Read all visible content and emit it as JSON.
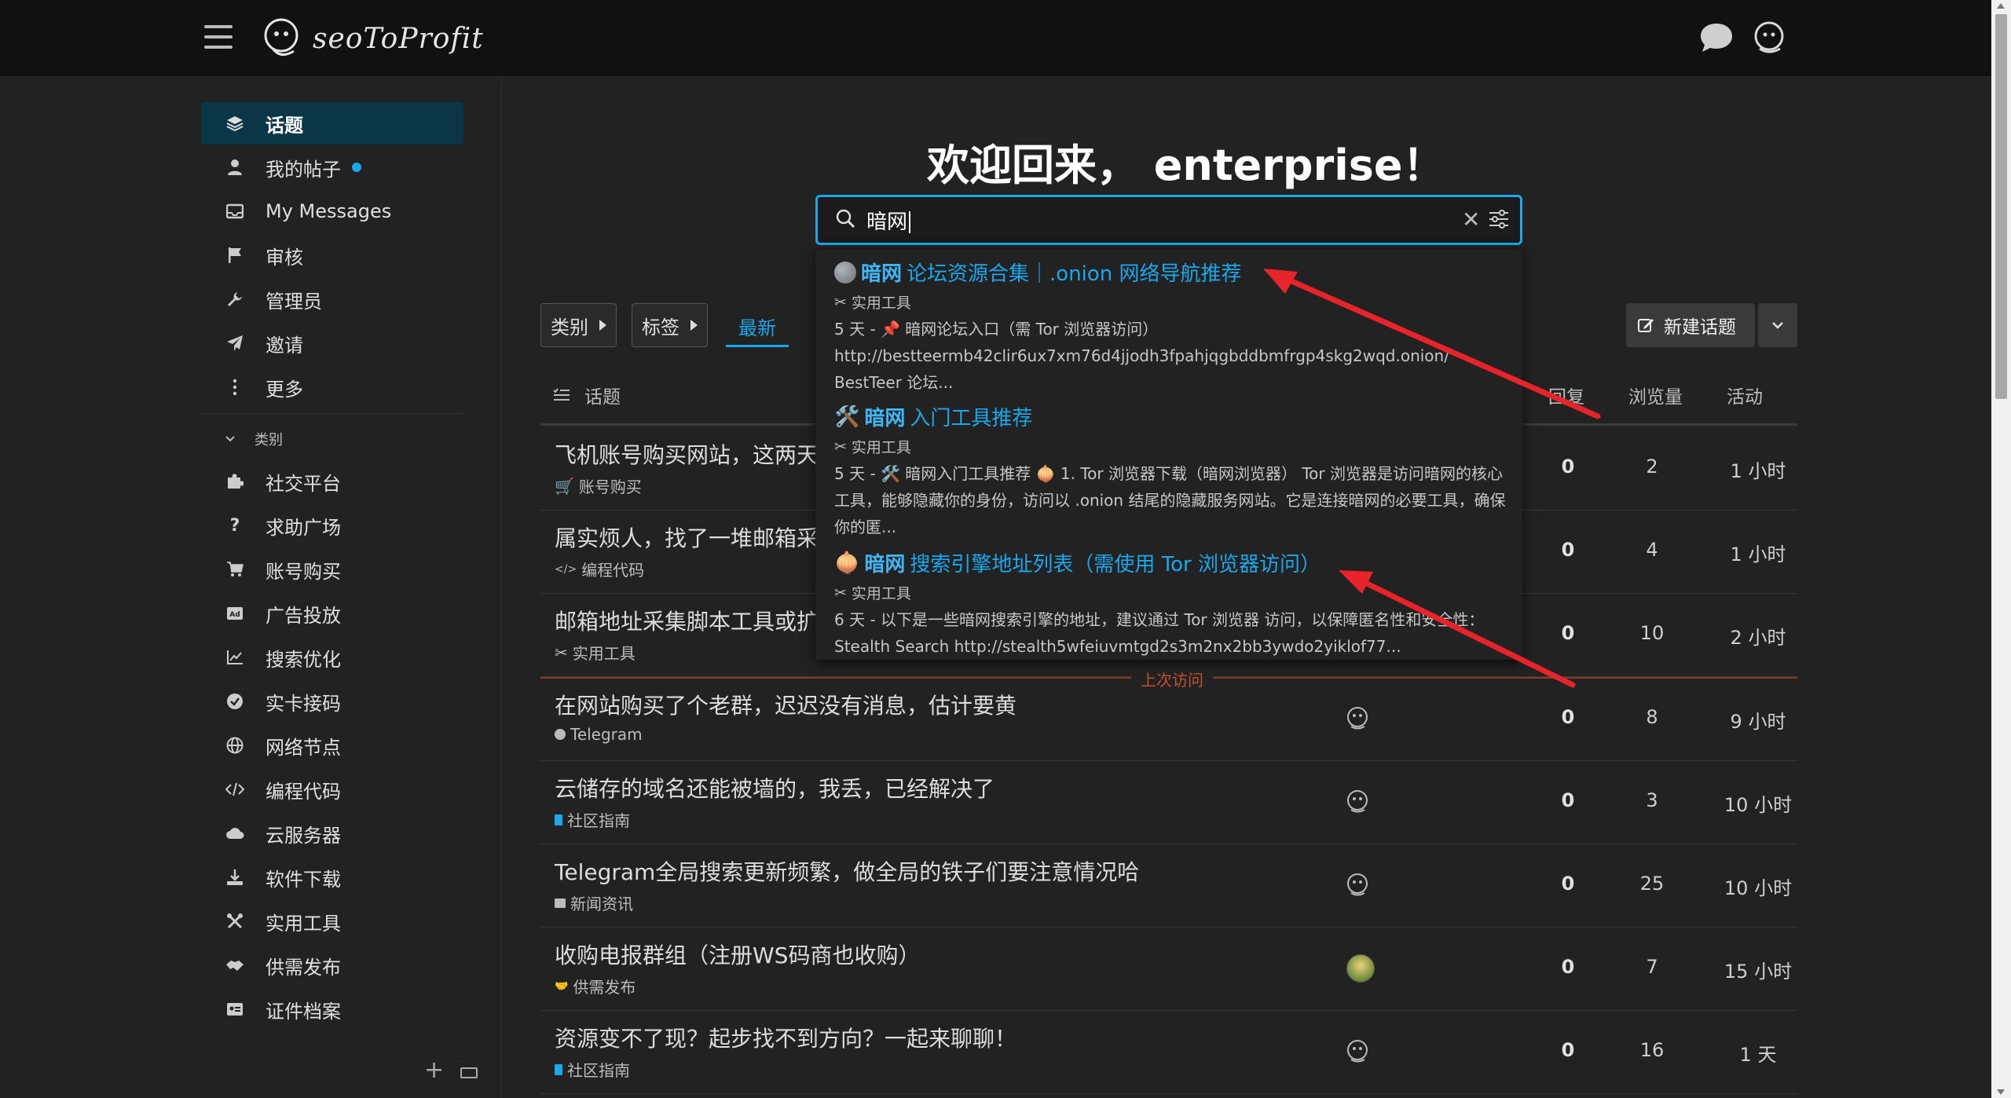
{
  "header": {
    "logo_text": "seoToProfit",
    "menu_icon": "hamburger-icon",
    "chat_icon": "chat-bubble-icon",
    "avatar_icon": "user-avatar-icon"
  },
  "sidebar": {
    "items": [
      {
        "label": "话题",
        "icon": "layers-icon",
        "active": true
      },
      {
        "label": "我的帖子",
        "icon": "user-icon",
        "dot": true
      },
      {
        "label": "My Messages",
        "icon": "inbox-icon"
      },
      {
        "label": "审核",
        "icon": "flag-icon"
      },
      {
        "label": "管理员",
        "icon": "wrench-icon"
      },
      {
        "label": "邀请",
        "icon": "paper-plane-icon"
      },
      {
        "label": "更多",
        "icon": "more-vertical-icon"
      }
    ],
    "categories_header": "类别",
    "categories": [
      {
        "label": "社交平台",
        "icon": "puzzle-icon"
      },
      {
        "label": "求助广场",
        "icon": "question-icon"
      },
      {
        "label": "账号购买",
        "icon": "cart-icon"
      },
      {
        "label": "广告投放",
        "icon": "ad-icon"
      },
      {
        "label": "搜索优化",
        "icon": "chart-line-icon"
      },
      {
        "label": "实卡接码",
        "icon": "check-circle-icon"
      },
      {
        "label": "网络节点",
        "icon": "globe-icon"
      },
      {
        "label": "编程代码",
        "icon": "code-icon"
      },
      {
        "label": "云服务器",
        "icon": "cloud-icon"
      },
      {
        "label": "软件下载",
        "icon": "download-icon"
      },
      {
        "label": "实用工具",
        "icon": "tools-icon"
      },
      {
        "label": "供需发布",
        "icon": "handshake-icon"
      },
      {
        "label": "证件档案",
        "icon": "id-card-icon"
      }
    ]
  },
  "main": {
    "welcome": "欢迎回来， enterprise！",
    "search": {
      "value": "暗网"
    },
    "results": [
      {
        "title_bold": "暗网",
        "title_rest": "论坛资源合集｜.onion 网络导航推荐",
        "category": "实用工具",
        "body": "5 天 - 📌 暗网论坛入口（需 Tor 浏览器访问）\nhttp://bestteermb42clir6ux7xm76d4jjodh3fpahjqgbddbmfrgp4skg2wqd.onion/\nBestTeer 论坛..."
      },
      {
        "title_bold": "暗网",
        "title_rest": "入门工具推荐",
        "category": "实用工具",
        "body": "5 天 - 🛠️ 暗网入门工具推荐 🧅 1. Tor 浏览器下载（暗网浏览器） Tor 浏览器是访问暗网的核心工具，能够隐藏你的身份，访问以 .onion 结尾的隐藏服务网站。它是连接暗网的必要工具，确保你的匿..."
      },
      {
        "title_bold": "暗网",
        "title_rest": "搜索引擎地址列表（需使用 Tor 浏览器访问）",
        "category": "实用工具",
        "body": "6 天 - 以下是一些暗网搜索引擎的地址，建议通过 Tor 浏览器 访问，以保障匿名性和安全性： Stealth Search http://stealth5wfeiuvmtgd2s3m2nx2bb3ywdo2yiklof77..."
      }
    ],
    "filters": {
      "categories_btn": "类别",
      "tags_btn": "标签",
      "latest_tab": "最新",
      "new_topic_btn": "新建话题"
    },
    "list_headers": {
      "topic": "话题",
      "replies": "回复",
      "views": "浏览量",
      "activity": "活动"
    },
    "last_visit_label": "上次访问",
    "topics": [
      {
        "title": "飞机账号购买网站，这两天",
        "category": "账号购买",
        "replies": "0",
        "views": "2",
        "activity": "1 小时"
      },
      {
        "title": "属实烦人，找了一堆邮箱采",
        "category": "编程代码",
        "replies": "0",
        "views": "4",
        "activity": "1 小时"
      },
      {
        "title": "邮箱地址采集脚本工具或扩",
        "category": "实用工具",
        "replies": "0",
        "views": "10",
        "activity": "2 小时"
      },
      {
        "title": "在网站购买了个老群，迟迟没有消息，估计要黄",
        "category": "Telegram",
        "replies": "0",
        "views": "8",
        "activity": "9 小时"
      },
      {
        "title": "云储存的域名还能被墙的，我丢，已经解决了",
        "category": "社区指南",
        "replies": "0",
        "views": "3",
        "activity": "10 小时"
      },
      {
        "title": "Telegram全局搜索更新频繁，做全局的铁子们要注意情况哈",
        "category": "新闻资讯",
        "replies": "0",
        "views": "25",
        "activity": "10 小时"
      },
      {
        "title": "收购电报群组（注册WS码商也收购）",
        "category": "供需发布",
        "replies": "0",
        "views": "7",
        "activity": "15 小时"
      },
      {
        "title": "资源变不了现？起步找不到方向？一起来聊聊！",
        "category": "社区指南",
        "replies": "0",
        "views": "16",
        "activity": "1 天"
      }
    ]
  },
  "colors": {
    "accent": "#1aa7ec",
    "active_bg": "#0b3648",
    "last_visit": "#c4502e",
    "arrow": "#e8232a"
  }
}
